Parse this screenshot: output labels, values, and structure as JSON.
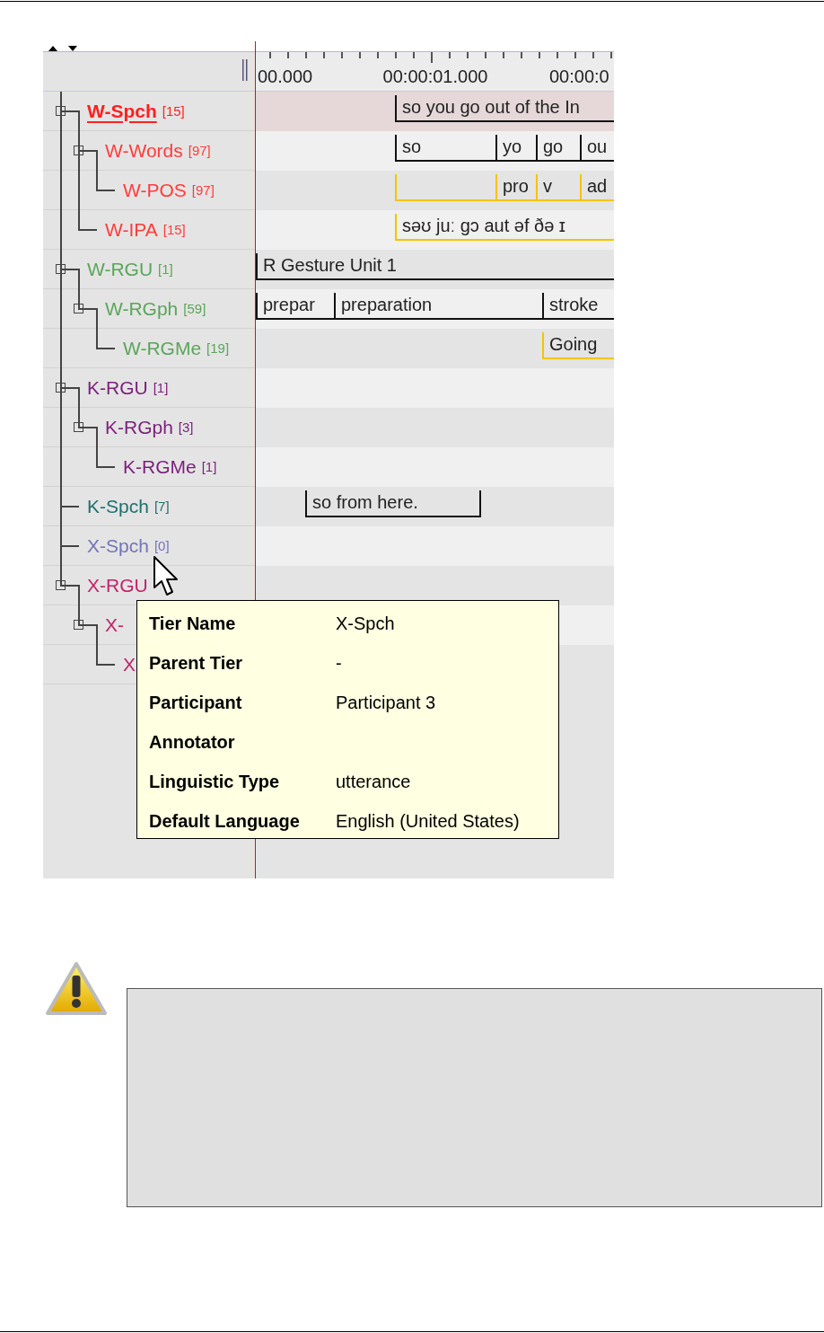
{
  "screenshot": {
    "tiers": [
      {
        "name": "W-Spch",
        "count": "[15]",
        "color": "#ff1f1f",
        "selected": true,
        "annotations": [
          {
            "kind": "aligned",
            "text": "so you go out of the In"
          }
        ],
        "children": [
          {
            "name": "W-Words",
            "count": "[97]",
            "color": "#ff3b3b",
            "selected": false,
            "annotations": [
              {
                "kind": "aligned",
                "text": "so"
              },
              {
                "kind": "aligned",
                "text": "yo"
              },
              {
                "kind": "aligned",
                "text": "go"
              },
              {
                "kind": "aligned",
                "text": "ou"
              }
            ],
            "children": [
              {
                "name": "W-POS",
                "count": "[97]",
                "color": "#ff3b3b",
                "selected": false,
                "annotations": [
                  {
                    "kind": "symbolic"
                  },
                  {
                    "kind": "symbolic",
                    "text": "pro"
                  },
                  {
                    "kind": "symbolic",
                    "text": "v"
                  },
                  {
                    "kind": "symbolic",
                    "text": "ad"
                  }
                ]
              }
            ]
          },
          {
            "name": "W-IPA",
            "count": "[15]",
            "color": "#ff3b3b",
            "selected": false,
            "annotations": [
              {
                "kind": "symbolic",
                "text": "səʊ  juː gɔ aut əf ðə ɪ"
              }
            ]
          }
        ]
      },
      {
        "name": "W-RGU",
        "count": "[1]",
        "color": "#5aa55a",
        "selected": false,
        "annotations": [
          {
            "kind": "aligned",
            "text": "R Gesture Unit 1"
          }
        ],
        "children": [
          {
            "name": "W-RGph",
            "count": "[59]",
            "color": "#5aa55a",
            "selected": false,
            "annotations": [
              {
                "kind": "aligned",
                "text": "prepar"
              },
              {
                "kind": "aligned",
                "text": "preparation"
              },
              {
                "kind": "aligned",
                "text": "stroke"
              }
            ],
            "children": [
              {
                "name": "W-RGMe",
                "count": "[19]",
                "color": "#5aa55a",
                "selected": false,
                "annotations": [
                  {
                    "kind": "symbolic",
                    "text": "Going"
                  }
                ]
              }
            ]
          }
        ]
      },
      {
        "name": "K-RGU",
        "count": "[1]",
        "color": "#7a1f7a",
        "selected": false,
        "children": [
          {
            "name": "K-RGph",
            "count": "[3]",
            "color": "#7a1f7a",
            "selected": false,
            "children": [
              {
                "name": "K-RGMe",
                "count": "[1]",
                "color": "#7a1f7a",
                "selected": false
              }
            ]
          }
        ]
      },
      {
        "name": "K-Spch",
        "count": "[7]",
        "color": "#1f6f6f",
        "selected": false,
        "annotations": [
          {
            "kind": "aligned",
            "text": "so from here."
          }
        ]
      },
      {
        "name": "X-Spch",
        "count": "[0]",
        "color": "#7474b8",
        "selected": false
      },
      {
        "name": "X-RGU",
        "color": "#c2226a",
        "selected": false,
        "children": [
          {
            "name": "X-",
            "color": "#c2226a",
            "selected": false,
            "children": [
              {
                "name": "X",
                "color": "#c2226a",
                "selected": false
              }
            ]
          }
        ]
      }
    ],
    "ruler_labels": [
      "00.000",
      "00:00:01.000",
      "00:00:0"
    ],
    "tooltip": {
      "rows": [
        {
          "label": "Tier Name",
          "value": "X-Spch"
        },
        {
          "label": "Parent Tier",
          "value": "-"
        },
        {
          "label": "Participant",
          "value": "Participant 3"
        },
        {
          "label": "Annotator"
        },
        {
          "label": "Linguistic Type",
          "value": "utterance"
        },
        {
          "label": "Default Language",
          "value": "English (United States)"
        }
      ]
    }
  }
}
